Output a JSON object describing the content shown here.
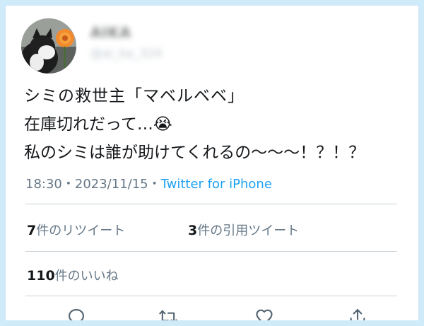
{
  "user": {
    "display_name": "AIKA",
    "handle": "@ai_ka_324"
  },
  "tweet": {
    "lines": [
      "シミの救世主「マベルベベ」",
      "在庫切れだって…😭",
      "私のシミは誰が助けてくれるの〜〜〜！？！？"
    ],
    "time": "18:30",
    "separator1": "・",
    "date": "2023/11/15",
    "separator2": "・",
    "source": "Twitter for iPhone"
  },
  "stats": {
    "retweets_count": "7",
    "retweets_label": "件のリツイート",
    "quotes_count": "3",
    "quotes_label": "件の引用ツイート",
    "likes_count": "110",
    "likes_label": "件のいいね"
  },
  "actions": [
    {
      "icon": "reply-icon"
    },
    {
      "icon": "retweet-icon"
    },
    {
      "icon": "like-icon"
    },
    {
      "icon": "share-icon"
    }
  ],
  "colors": {
    "frame_border": "#cfeaf8",
    "text": "#14171a",
    "secondary": "#657786",
    "link": "#1da1f2",
    "icon": "#536471"
  }
}
